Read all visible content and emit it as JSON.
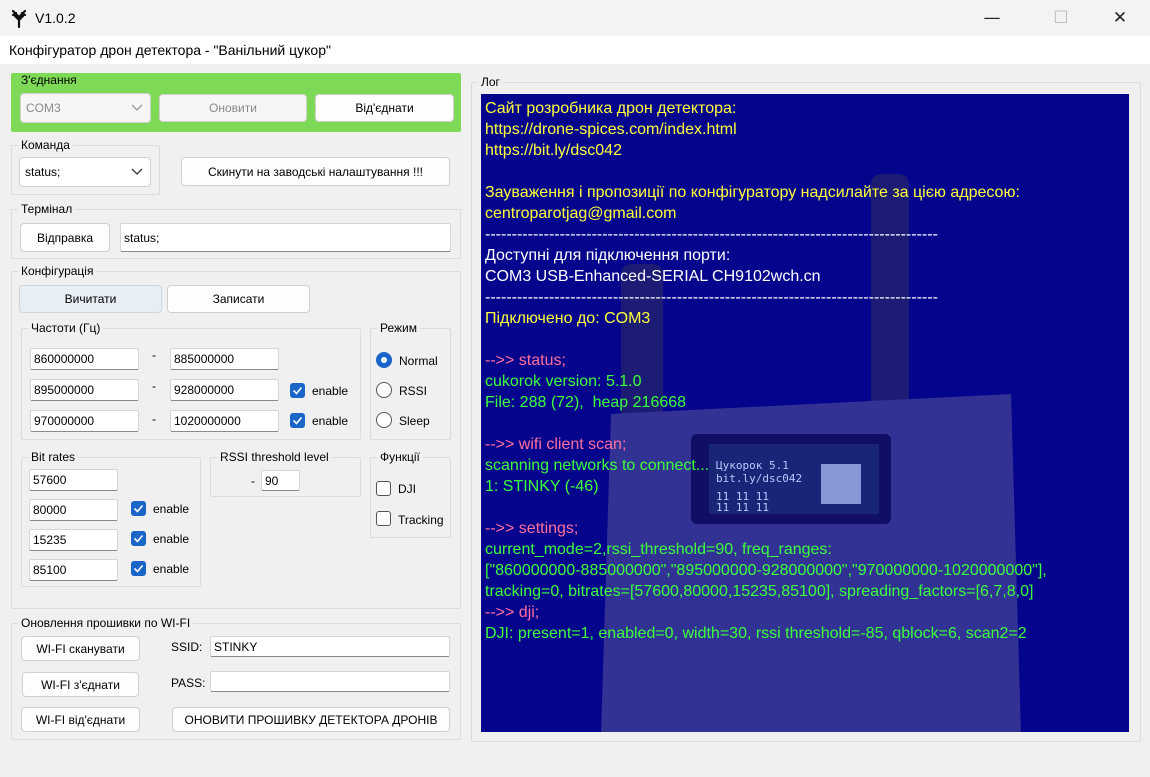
{
  "window": {
    "title": "V1.0.2",
    "minimize": "—",
    "maximize": "☐",
    "close": "✕",
    "heading": "Конфігуратор дрон детектора - \"Ванільний цукор\""
  },
  "connection": {
    "label": "З'єднання",
    "port": "COM3",
    "refresh": "Оновити",
    "disconnect": "Від'єднати",
    "accent_color": "#7ed957"
  },
  "command": {
    "label": "Команда",
    "selected": "status;",
    "factory_reset": "Скинути на заводські налаштування !!!"
  },
  "terminal": {
    "label": "Термінал",
    "send": "Відправка",
    "input_value": "status;"
  },
  "config": {
    "label": "Конфігурація",
    "read": "Вичитати",
    "write": "Записати",
    "freq": {
      "label": "Частоти (Гц)",
      "dash": "-",
      "ranges": [
        {
          "from": "860000000",
          "to": "885000000"
        },
        {
          "from": "895000000",
          "to": "928000000",
          "enable": "enable",
          "checked": true
        },
        {
          "from": "970000000",
          "to": "1020000000",
          "enable": "enable",
          "checked": true
        }
      ]
    },
    "mode": {
      "label": "Режим",
      "options": [
        "Normal",
        "RSSI",
        "Sleep"
      ],
      "selected": "Normal"
    },
    "bitrates": {
      "label": "Bit rates",
      "values": [
        "57600",
        "80000",
        "15235",
        "85100"
      ],
      "enable": "enable"
    },
    "rssi": {
      "label": "RSSI threshold level",
      "sign": "-",
      "value": "90"
    },
    "functions": {
      "label": "Функції",
      "dji": "DJI",
      "tracking": "Tracking"
    }
  },
  "wifi": {
    "label": "Оновлення прошивки по WI-FI",
    "scan": "WI-FI сканувати",
    "connect": "WI-FI з'єднати",
    "disconnect": "WI-FI від'єднати",
    "ssid_label": "SSID:",
    "ssid_value": "STINKY",
    "pass_label": "PASS:",
    "pass_value": "",
    "update": "ОНОВИТИ ПРОШИВКУ ДЕТЕКТОРА ДРОНІВ"
  },
  "log": {
    "label": "Лог",
    "background": "#05048c",
    "lines": [
      {
        "text": "Сайт розробника дрон детектора:",
        "color": "yellow"
      },
      {
        "text": "https://drone-spices.com/index.html",
        "color": "yellow"
      },
      {
        "text": "https://bit.ly/dsc042",
        "color": "yellow"
      },
      {
        "text": "",
        "color": "yellow"
      },
      {
        "text": "Зауваження і пропозиції по конфігуратору надсилайте за цією адресою:",
        "color": "yellow"
      },
      {
        "text": "centroparotjag@gmail.com",
        "color": "yellow"
      },
      {
        "text": "-------------------------------------------------------------------------------------",
        "color": "white"
      },
      {
        "text": "Доступні для підключення порти:",
        "color": "white"
      },
      {
        "text": "COM3 USB-Enhanced-SERIAL CH9102wch.cn",
        "color": "white"
      },
      {
        "text": "-------------------------------------------------------------------------------------",
        "color": "white"
      },
      {
        "text": "Підключено до: COM3",
        "color": "yellow"
      },
      {
        "text": "",
        "color": "white"
      },
      {
        "text": "-->> status;",
        "color": "pink"
      },
      {
        "text": "cukorok version: 5.1.0",
        "color": "green"
      },
      {
        "text": "File: 288 (72),  heap 216668",
        "color": "green"
      },
      {
        "text": "",
        "color": "green"
      },
      {
        "text": "-->> wifi client scan;",
        "color": "pink"
      },
      {
        "text": "scanning networks to connect...",
        "color": "green"
      },
      {
        "text": "1: STINKY (-46)",
        "color": "green"
      },
      {
        "text": "",
        "color": "green"
      },
      {
        "text": "-->> settings;",
        "color": "pink"
      },
      {
        "text": "current_mode=2,rssi_threshold=90, freq_ranges:",
        "color": "green"
      },
      {
        "text": "[\"860000000-885000000\",\"895000000-928000000\",\"970000000-1020000000\"],",
        "color": "green"
      },
      {
        "text": "tracking=0, bitrates=[57600,80000,15235,85100], spreading_factors=[6,7,8,0]",
        "color": "green"
      },
      {
        "text": "-->> dji;",
        "color": "pink"
      },
      {
        "text": "DJI: present=1, enabled=0, width=30, rssi threshold=-85, qblock=6, scan2=2",
        "color": "green"
      }
    ],
    "device_screen": {
      "line1": "Цукорок 5.1",
      "line2": "bit.ly/dsc042",
      "line3": "11 11 11",
      "line4": "11 11 11"
    }
  }
}
